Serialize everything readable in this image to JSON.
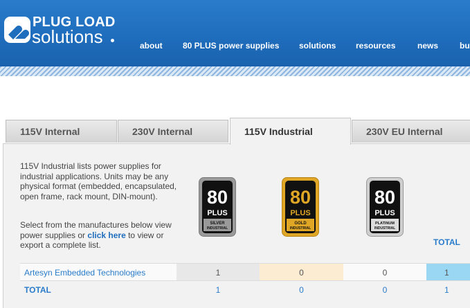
{
  "brand": {
    "line1": "PLUG LOAD",
    "line2": "solutions"
  },
  "nav": [
    {
      "label": "about"
    },
    {
      "label": "80 PLUS power supplies"
    },
    {
      "label": "solutions"
    },
    {
      "label": "resources"
    },
    {
      "label": "news"
    },
    {
      "label": "buy"
    }
  ],
  "tabs": [
    {
      "label": "115V Internal",
      "active": false
    },
    {
      "label": "230V Internal",
      "active": false
    },
    {
      "label": "115V Industrial",
      "active": true
    },
    {
      "label": "230V EU Internal",
      "active": false
    }
  ],
  "description": "115V Industrial lists power supplies for industrial applications. Units may be any physical format (embedded, encapsulated, open frame, rack mount, DIN-mount).",
  "instructions": {
    "before": "Select from the manufactures below view power supplies or ",
    "link": "click here",
    "after": " to view or export a complete list."
  },
  "badges": [
    {
      "number": "80",
      "plus": "PLUS",
      "tier": "SILVER",
      "sub": "INDUSTRIAL",
      "color": "#9a9a9a"
    },
    {
      "number": "80",
      "plus": "PLUS",
      "tier": "GOLD",
      "sub": "INDUSTRIAL",
      "color": "#e0a726"
    },
    {
      "number": "80",
      "plus": "PLUS",
      "tier": "PLATINUM",
      "sub": "INDUSTRIAL",
      "color": "#cfcfcf"
    }
  ],
  "table": {
    "total_header": "TOTAL",
    "rows": [
      {
        "name": "Artesyn Embedded Technologies",
        "silver": "1",
        "gold": "0",
        "platinum": "0",
        "total": "1"
      }
    ],
    "totals": {
      "label": "TOTAL",
      "silver": "1",
      "gold": "0",
      "platinum": "0",
      "total": "1"
    }
  },
  "colors": {
    "header_blue": "#1f6dbd",
    "link_blue": "#2a7ccb",
    "gold_cell": "#fbecd2",
    "total_cell": "#99d7f3"
  }
}
